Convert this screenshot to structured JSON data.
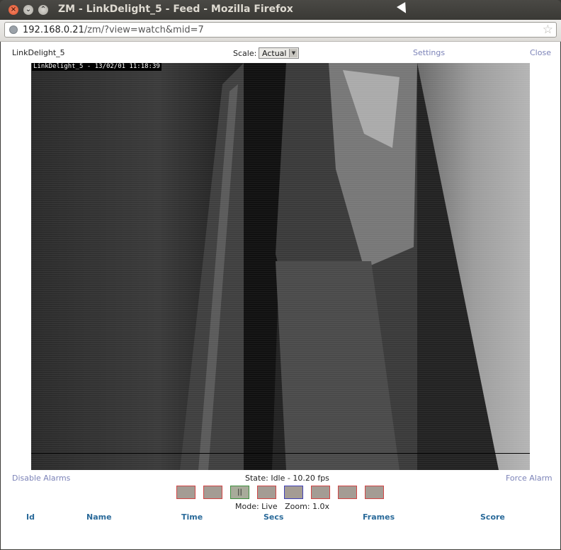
{
  "window": {
    "title": "ZM - LinkDelight_5 - Feed - Mozilla Firefox",
    "buttons": {
      "close": "×",
      "minimize": "⌄",
      "maximize": "⌃"
    }
  },
  "browser": {
    "url_host": "192.168.0.21",
    "url_path": "/zm/?view=watch&mid=7",
    "bookmark_icon": "star-icon",
    "site_icon": "globe-icon"
  },
  "header": {
    "monitor_name": "LinkDelight_5",
    "scale_label": "Scale:",
    "scale_value": "Actual",
    "settings_link": "Settings",
    "close_link": "Close"
  },
  "feed": {
    "timestamp": "LinkDelight_5 - 13/02/01 11:18:39"
  },
  "status": {
    "disable_alarms": "Disable Alarms",
    "state": "State: Idle - 10.20 fps",
    "force_alarm": "Force Alarm",
    "mode": "Mode: Live   Zoom: 1.0x"
  },
  "controls": [
    {
      "name": "fast-reverse",
      "label": ""
    },
    {
      "name": "slow-reverse",
      "label": ""
    },
    {
      "name": "pause",
      "label": "||"
    },
    {
      "name": "stop",
      "label": ""
    },
    {
      "name": "play",
      "label": ""
    },
    {
      "name": "slow-forward",
      "label": ""
    },
    {
      "name": "fast-forward",
      "label": ""
    },
    {
      "name": "zoom-out",
      "label": ""
    }
  ],
  "events_table": {
    "columns": [
      "Id",
      "Name",
      "Time",
      "Secs",
      "Frames",
      "Score"
    ]
  },
  "colors": {
    "link": "#7c83b8",
    "table_header": "#2a6a9a",
    "control_border": "#d24545",
    "active_border": "#3e8f3e",
    "selected_border": "#4040b8"
  }
}
